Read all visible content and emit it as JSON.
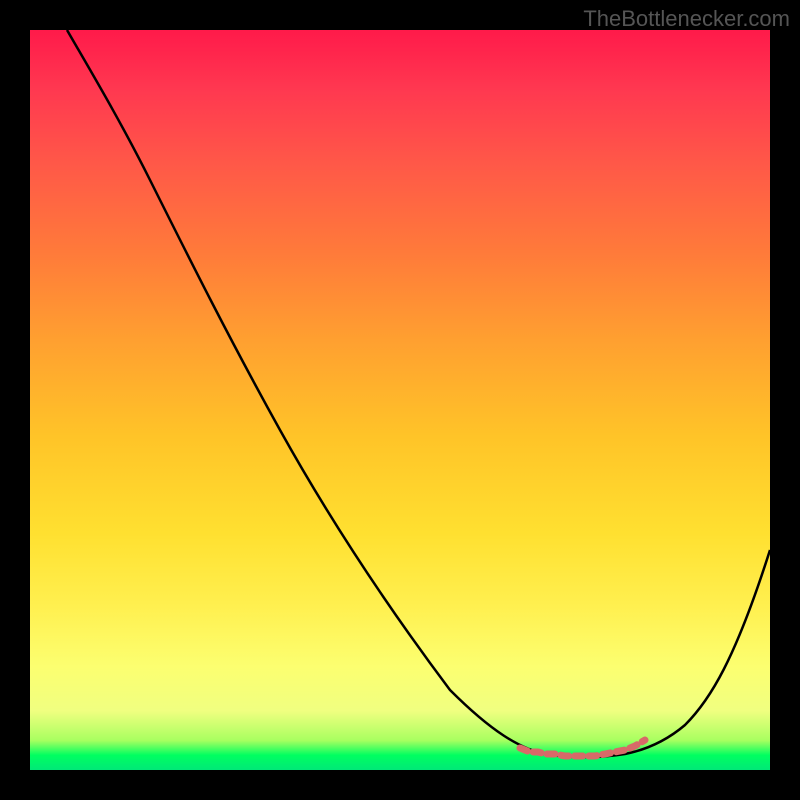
{
  "watermark": "TheBottlenecker.com",
  "chart_data": {
    "type": "line",
    "title": "",
    "xlabel": "",
    "ylabel": "",
    "xlim": [
      0,
      100
    ],
    "ylim": [
      0,
      100
    ],
    "series": [
      {
        "name": "curve",
        "color": "#000000",
        "x": [
          5,
          10,
          15,
          20,
          25,
          30,
          35,
          40,
          45,
          50,
          55,
          60,
          65,
          70,
          75,
          80,
          85,
          90,
          95,
          100
        ],
        "y": [
          100,
          94,
          87,
          80,
          72,
          64,
          56,
          48,
          40,
          32,
          24,
          16,
          8,
          3,
          1,
          1,
          3,
          9,
          18,
          30
        ]
      },
      {
        "name": "highlight",
        "color": "#d86a68",
        "x": [
          70,
          72,
          76,
          80,
          84,
          86
        ],
        "y": [
          3,
          2,
          1.5,
          1.5,
          2.5,
          4
        ]
      }
    ],
    "gradient_stops": [
      {
        "pos": 0,
        "color": "#ff1a4a"
      },
      {
        "pos": 50,
        "color": "#ffc428"
      },
      {
        "pos": 85,
        "color": "#fcff70"
      },
      {
        "pos": 100,
        "color": "#00e878"
      }
    ]
  }
}
